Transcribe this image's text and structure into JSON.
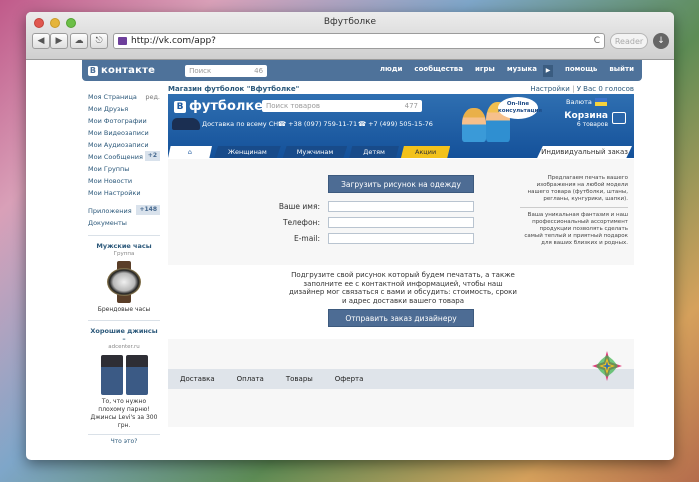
{
  "browser": {
    "title": "Вфутболке",
    "url": "http://vk.com/app?",
    "reader_label": "Reader",
    "back": "◀",
    "forward": "▶",
    "share": "⎋",
    "reload": "C"
  },
  "vk": {
    "logo_letter": "B",
    "logo_text": "контакте",
    "search_placeholder": "Поиск",
    "search_count": "46",
    "nav": [
      "люди",
      "сообщества",
      "игры",
      "музыка",
      "помощь",
      "выйти"
    ]
  },
  "sidebar": {
    "items": [
      {
        "label": "Моя Страница",
        "extra": "ред."
      },
      {
        "label": "Мои Друзья",
        "extra": ""
      },
      {
        "label": "Мои Фотографии",
        "extra": ""
      },
      {
        "label": "Мои Видеозаписи",
        "extra": ""
      },
      {
        "label": "Мои Аудиозаписи",
        "extra": ""
      },
      {
        "label": "Мои Сообщения",
        "extra": "+2"
      },
      {
        "label": "Мои Группы",
        "extra": ""
      },
      {
        "label": "Мои Новости",
        "extra": ""
      },
      {
        "label": "Мои Настройки",
        "extra": ""
      }
    ],
    "items2": [
      {
        "label": "Приложения",
        "extra": "+148"
      },
      {
        "label": "Документы",
        "extra": ""
      }
    ],
    "ad1": {
      "title": "Мужские часы",
      "sub": "Группа",
      "text": "Брендовые часы"
    },
    "ad2": {
      "title": "Хорошие джинсы –",
      "sub": "adcenter.ru",
      "text": "То, что нужно плохому парню! Джинсы Levi's за 300 грн."
    },
    "whats_this": "Что это?"
  },
  "app": {
    "header_title": "Магазин футболок \"Вфутболке\"",
    "settings": "Настройки",
    "votes": "У Вас 0 голосов",
    "shop_logo_letter": "B",
    "shop_logo_text": "футболке",
    "shop_search_placeholder": "Поиск товаров",
    "shop_search_count": "477",
    "delivery": "Доставка по всему СНГ",
    "phone1": "+38 (097) 759-11-71",
    "phone2": "+7 (499) 505-15-76",
    "bubble": "On-line консультация",
    "currency": "Валюта",
    "cart_title": "Корзина",
    "cart_count": "6 товаров",
    "tabs": [
      "Женщинам",
      "Мужчинам",
      "Детям",
      "Акции"
    ],
    "individual_order": "Индивидуальный заказ",
    "upload_button": "Загрузить рисунок на одежду",
    "labels": {
      "name": "Ваше имя:",
      "phone": "Телефон:",
      "email": "E-mail:"
    },
    "info1": "Предлагаем печать вашего изображения на любой модели нашего товара (футболки, штаны, регланы, кунгурики, шапки).",
    "info2": "Ваша уникальная фантазия и наш профессиональный ассортимент продукции позволять сделать самый теплый и приятный подарок для ваших близких и родных.",
    "description": "Подгрузите свой рисунок который будем печатать, а также заполните ее с контактной информацией, чтобы наш дизайнер мог связаться с вами и обсудить: стоимость, сроки и адрес доставки вашего товара",
    "order_button": "Отправить заказ дизайнеру",
    "footer": [
      "Доставка",
      "Оплата",
      "Товары",
      "Оферта"
    ]
  }
}
